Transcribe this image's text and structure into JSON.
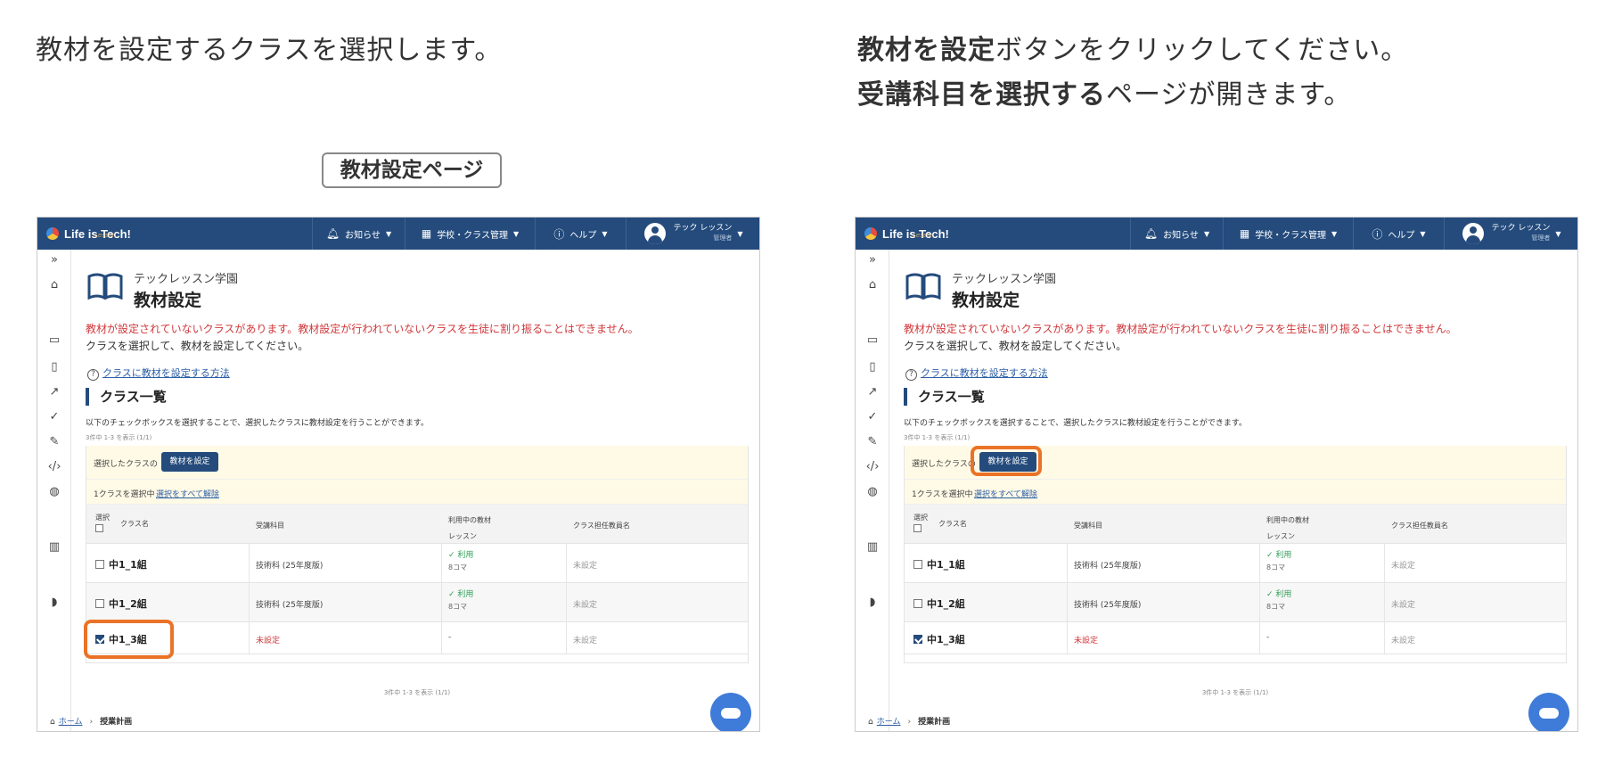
{
  "instructions": {
    "left": "教材を設定するクラスを選択します。",
    "right_line1_bold": "教材を設定",
    "right_line1_rest": "ボタンをクリックしてください。",
    "right_line2_bold": "受講科目を選択する",
    "right_line2_rest": "ページが開きます。"
  },
  "page_tag": "教材設定ページ",
  "app": {
    "logo": "Life is Tech!",
    "logo_sub": "Lesson",
    "nav": {
      "news": "お知らせ",
      "school": "学校・クラス管理",
      "help": "ヘルプ",
      "user_name": "テック レッスン",
      "user_role": "管理者"
    },
    "school_name": "テックレッスン学園",
    "title": "教材設定",
    "warning": "教材が設定されていないクラスがあります。教材設定が行われていないクラスを生徒に割り振ることはできません。",
    "note": "クラスを選択して、教材を設定してください。",
    "help_link": "クラスに教材を設定する方法",
    "section_title": "クラス一覧",
    "description": "以下のチェックボックスを選択することで、選択したクラスに教材設定を行うことができます。",
    "count": "3件中 1-3 を表示 (1/1)",
    "bar": {
      "label": "選択したクラスの",
      "button": "教材を設定",
      "selected_count": "1クラスを選択中",
      "clear": "選択をすべて解除"
    },
    "headers": {
      "select": "選択",
      "name": "クラス名",
      "subject": "受講科目",
      "material_line1": "利用中の教材",
      "material_line2": "レッスン",
      "teacher": "クラス担任教員名"
    },
    "rows": [
      {
        "name": "中1_1組",
        "subject": "技術科 (25年度版)",
        "use": "✓ 利用",
        "koma": "8コマ",
        "teacher": "未設定",
        "checked": false
      },
      {
        "name": "中1_2組",
        "subject": "技術科 (25年度版)",
        "use": "✓ 利用",
        "koma": "8コマ",
        "teacher": "未設定",
        "checked": false
      },
      {
        "name": "中1_3組",
        "subject": "未設定",
        "use": "-",
        "koma": "",
        "teacher": "未設定",
        "checked": true
      }
    ],
    "breadcrumb": {
      "home": "ホーム",
      "current": "授業計画"
    }
  },
  "colors": {
    "nav_bg": "#244b7c",
    "highlight": "#ea7327",
    "warning": "#d0383b",
    "chat": "#3f7bd8"
  },
  "icons": [
    "bell-icon",
    "building-icon",
    "help-circle-icon",
    "user-avatar-icon",
    "book-icon",
    "home-icon",
    "chevron-right-icon",
    "chat-icon"
  ]
}
